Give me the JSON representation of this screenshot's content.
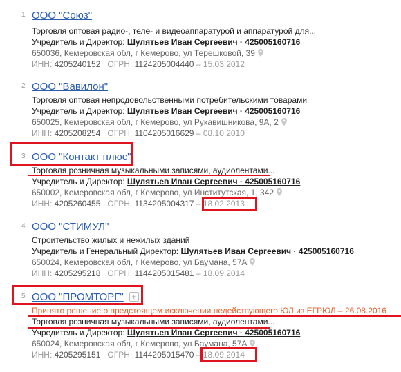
{
  "labels": {
    "inn": "ИНН:",
    "ogrn": "ОГРН:",
    "dash": "–"
  },
  "entries": [
    {
      "num": "1",
      "name": "ООО \"Союз\"",
      "activity": "Торговля оптовая радио-, теле- и видеоаппаратурой и аппаратурой для...",
      "role": "Учредитель и Директор:",
      "person": "Шулятьев Иван Сергеевич · 425005160716",
      "address": "650036, Кемеровская обл, г Кемерово, ул Терешковой, 39",
      "inn": "4205240152",
      "ogrn": "1124205004440",
      "date": "15.03.2012"
    },
    {
      "num": "2",
      "name": "ООО \"Вавилон\"",
      "activity": "Торговля оптовая непродовольственными потребительскими товарами",
      "role": "Учредитель и Директор:",
      "person": "Шулятьев Иван Сергеевич · 425005160716",
      "address": "650025, Кемеровская обл, г Кемерово, ул Рукавишникова, 9А, 2",
      "inn": "4205208254",
      "ogrn": "1104205016629",
      "date": "08.10.2010"
    },
    {
      "num": "3",
      "name": "ООО \"Контакт плюс\"",
      "activity": "Торговля розничная музыкальными записями, аудиолентами...",
      "role": "Учредитель и Директор:",
      "person": "Шулятьев Иван Сергеевич · 425005160716",
      "address": "650002, Кемеровская обл, г Кемерово, ул Институтская, 1, 342",
      "inn": "4205260455",
      "ogrn": "1134205004317",
      "date": "18.02.2013"
    },
    {
      "num": "4",
      "name": "ООО \"СТИМУЛ\"",
      "activity": "Строительство жилых и нежилых зданий",
      "role": "Учредитель и Генеральный Директор:",
      "person": "Шулятьев Иван Сергеевич · 425005160716",
      "address": "650024, Кемеровская обл, г Кемерово, ул Баумана, 57А",
      "inn": "4205295218",
      "ogrn": "1144205015481",
      "date": "18.09.2014"
    },
    {
      "num": "5",
      "name": "ООО \"ПРОМТОРГ\"",
      "plus": "+",
      "notice": "Принято решение о предстоящем исключении недействующего ЮЛ из ЕГРЮЛ – 26.08.2016",
      "activity": "Торговля розничная музыкальными записями, аудиолентами...",
      "role": "Учредитель и Директор:",
      "person": "Шулятьев Иван Сергеевич · 425005160716",
      "address": "650024, Кемеровская обл, г Кемерово, ул Баумана, 57А",
      "inn": "4205295151",
      "ogrn": "1144205015470",
      "date": "18.09.2014"
    }
  ],
  "annotation_color": "#e0141e"
}
